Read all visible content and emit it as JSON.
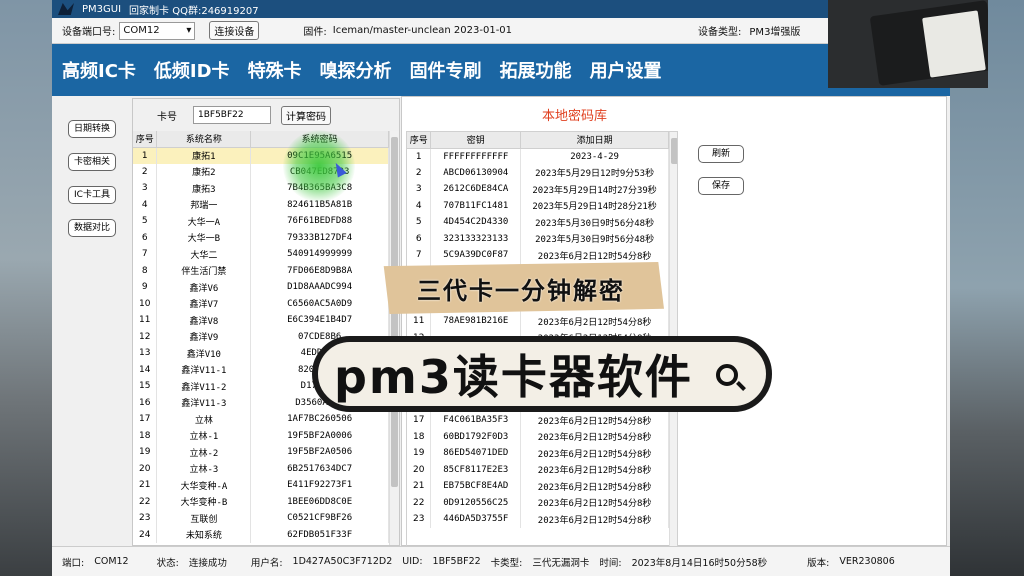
{
  "title_bar": {
    "app": "PM3GUI",
    "subtitle": "回家制卡 QQ群:246919207"
  },
  "toolbar": {
    "port_label": "设备端口号:",
    "port_value": "COM12",
    "connect": "连接设备",
    "firmware_label": "固件:",
    "firmware_value": "Iceman/master-unclean 2023-01-01",
    "device_type_label": "设备类型:",
    "device_type_value": "PM3增强版"
  },
  "menu": [
    "高频IC卡",
    "低频ID卡",
    "特殊卡",
    "嗅探分析",
    "固件专刷",
    "拓展功能",
    "用户设置"
  ],
  "left_nav": [
    "日期转换",
    "卡密相关",
    "IC卡工具",
    "数据对比"
  ],
  "card": {
    "label": "卡号",
    "value": "1BF5BF22",
    "calc_button": "计算密码"
  },
  "system_table": {
    "headers": [
      "序号",
      "系统名称",
      "系统密码"
    ],
    "rows": [
      [
        "1",
        "康拓1",
        "09C1E95A6515"
      ],
      [
        "2",
        "康拓2",
        "CB047ED8723"
      ],
      [
        "3",
        "康拓3",
        "7B4B365BA3C8"
      ],
      [
        "4",
        "邦瑞一",
        "824611B5A81B"
      ],
      [
        "5",
        "大华一A",
        "76F61BEDFD88"
      ],
      [
        "6",
        "大华一B",
        "79333B127DF4"
      ],
      [
        "7",
        "大华二",
        "540914999999"
      ],
      [
        "8",
        "伴生活门禁",
        "7FD06E8D9B8A"
      ],
      [
        "9",
        "鑫洋V6",
        "D1D8AAADC994"
      ],
      [
        "10",
        "鑫洋V7",
        "C6560AC5A0D9"
      ],
      [
        "11",
        "鑫洋V8",
        "E6C394E1B4D7"
      ],
      [
        "12",
        "鑫洋V9",
        "07CDE8B6"
      ],
      [
        "13",
        "鑫洋V10",
        "4EDD155"
      ],
      [
        "14",
        "鑫洋V11-1",
        "82023719"
      ],
      [
        "15",
        "鑫洋V11-2",
        "D170B14"
      ],
      [
        "16",
        "鑫洋V11-3",
        "D3560AC5F"
      ],
      [
        "17",
        "立林",
        "1AF7BC260506"
      ],
      [
        "18",
        "立林-1",
        "19F5BF2A0006"
      ],
      [
        "19",
        "立林-2",
        "19F5BF2A0506"
      ],
      [
        "20",
        "立林-3",
        "6B2517634DC7"
      ],
      [
        "21",
        "大华变种-A",
        "E411F92273F1"
      ],
      [
        "22",
        "大华变种-B",
        "1BEE06DD8C0E"
      ],
      [
        "23",
        "互联创",
        "C0521CF9BF26"
      ],
      [
        "24",
        "未知系统",
        "62FDB051F33F"
      ]
    ]
  },
  "key_library": {
    "title": "本地密码库",
    "headers": [
      "序号",
      "密钥",
      "添加日期"
    ],
    "rows": [
      [
        "1",
        "FFFFFFFFFFFF",
        "2023-4-29"
      ],
      [
        "2",
        "ABCD06130904",
        "2023年5月29日12时9分53秒"
      ],
      [
        "3",
        "2612C6DE84CA",
        "2023年5月29日14时27分39秒"
      ],
      [
        "4",
        "707B11FC1481",
        "2023年5月29日14时28分21秒"
      ],
      [
        "5",
        "4D454C2D4330",
        "2023年5月30日9时56分48秒"
      ],
      [
        "6",
        "323133323133",
        "2023年5月30日9时56分48秒"
      ],
      [
        "7",
        "5C9A39DC0F87",
        "2023年6月2日12时54分8秒"
      ],
      [
        "8",
        "",
        "2023年6月2日12时54分8秒"
      ],
      [
        "9",
        "",
        "2023年6月2日12时54分8秒"
      ],
      [
        "10",
        "",
        "2023年6月2日12时54分8秒"
      ],
      [
        "11",
        "78AE981B216E",
        "2023年6月2日12时54分8秒"
      ],
      [
        "12",
        "",
        "2023年6月2日12时54分8秒"
      ],
      [
        "13",
        "",
        "2023年6月2日12时54分8秒"
      ],
      [
        "14",
        "",
        "2023年6月2日12时54分8秒"
      ],
      [
        "15",
        "",
        "2023年6月2日12时54分8秒"
      ],
      [
        "16",
        "",
        "2023年6月2日12时54分8秒"
      ],
      [
        "17",
        "F4C061BA35F3",
        "2023年6月2日12时54分8秒"
      ],
      [
        "18",
        "60BD1792F0D3",
        "2023年6月2日12时54分8秒"
      ],
      [
        "19",
        "86ED54071DED",
        "2023年6月2日12时54分8秒"
      ],
      [
        "20",
        "85CF8117E2E3",
        "2023年6月2日12时54分8秒"
      ],
      [
        "21",
        "EB75BCF8E4AD",
        "2023年6月2日12时54分8秒"
      ],
      [
        "22",
        "0D9120556C25",
        "2023年6月2日12时54分8秒"
      ],
      [
        "23",
        "446DA5D3755F",
        "2023年6月2日12时54分8秒"
      ]
    ],
    "refresh": "刷新",
    "save": "保存"
  },
  "status": {
    "port_label": "端口:",
    "port_value": "COM12",
    "state_label": "状态:",
    "state_value": "连接成功",
    "user_label": "用户名:",
    "user_value": "1D427A50C3F712D2",
    "uid_label": "UID:",
    "uid_value": "1BF5BF22",
    "type_label": "卡类型:",
    "type_value": "三代无漏洞卡",
    "time_label": "时间:",
    "time_value": "2023年8月14日16时50分58秒",
    "version_label": "版本:",
    "version_value": "VER230806"
  },
  "overlays": {
    "banner": "三代卡一分钟解密",
    "search_text": "pm3读卡器软件"
  },
  "colors": {
    "menu_bg": "#1b66a3",
    "title_bg": "#1c4f7e",
    "selected_row": "#fbf1bd",
    "library_title": "#e04020",
    "cursor_highlight": "#3cc83c"
  }
}
